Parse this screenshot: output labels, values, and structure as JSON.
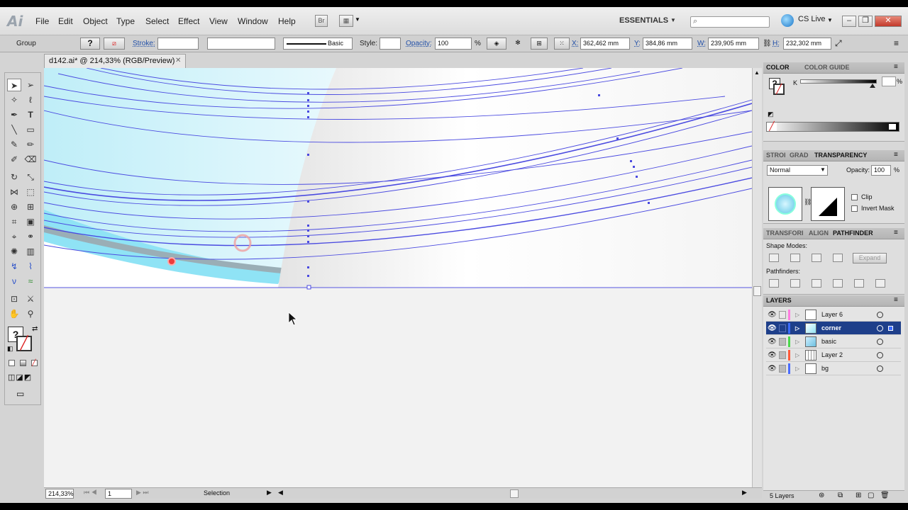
{
  "app": {
    "logo": "Ai"
  },
  "menu": [
    "File",
    "Edit",
    "Object",
    "Type",
    "Select",
    "Effect",
    "View",
    "Window",
    "Help"
  ],
  "bridge_label": "Br",
  "workspace": "ESSENTIALS",
  "cs_live": "CS Live",
  "window_buttons": {
    "min": "–",
    "restore": "❐",
    "close": "✕"
  },
  "control": {
    "selection_type": "Group",
    "stroke_label": "Stroke:",
    "brush_label": "Basic",
    "style_label": "Style:",
    "opacity_label": "Opacity:",
    "opacity_value": "100",
    "opacity_unit": "%",
    "x_label": "X:",
    "x_value": "362,462 mm",
    "y_label": "Y:",
    "y_value": "384,86 mm",
    "w_label": "W:",
    "w_value": "239,905 mm",
    "h_label": "H:",
    "h_value": "232,302 mm",
    "fill_glyph": "?"
  },
  "document": {
    "tab_title": "d142.ai* @ 214,33% (RGB/Preview)",
    "close": "✕"
  },
  "status": {
    "zoom": "214,33%",
    "page": "1",
    "tool": "Selection"
  },
  "panels": {
    "color": {
      "tabs": [
        "COLOR",
        "COLOR GUIDE"
      ],
      "channel": "K",
      "unit": "%",
      "swatch_glyph": "?"
    },
    "transparency": {
      "tabs": [
        "STROI",
        "GRAD",
        "TRANSPARENCY"
      ],
      "blend_mode": "Normal",
      "opacity_label": "Opacity:",
      "opacity_value": "100",
      "unit": "%",
      "clip": "Clip",
      "invert_mask": "Invert Mask"
    },
    "pathfinder": {
      "tabs": [
        "TRANSFORI",
        "ALIGN",
        "PATHFINDER"
      ],
      "shape_modes": "Shape Modes:",
      "expand": "Expand",
      "pathfinders": "Pathfinders:"
    },
    "layers": {
      "tab": "LAYERS",
      "items": [
        {
          "name": "Layer 6",
          "color": "#ff7de0",
          "selected": false,
          "locked": false
        },
        {
          "name": "corner",
          "color": "#3a6bff",
          "selected": true,
          "locked": false
        },
        {
          "name": "basic",
          "color": "#4bd84b",
          "selected": false,
          "locked": true
        },
        {
          "name": "Layer 2",
          "color": "#ff5a3a",
          "selected": false,
          "locked": true
        },
        {
          "name": "bg",
          "color": "#4a6cff",
          "selected": false,
          "locked": true
        }
      ],
      "count": "5 Layers"
    }
  },
  "colors": {
    "selection": "#3f3fd9",
    "layer_selected": "#1e3f8a",
    "cyan_fill": "#8fe3f5"
  }
}
